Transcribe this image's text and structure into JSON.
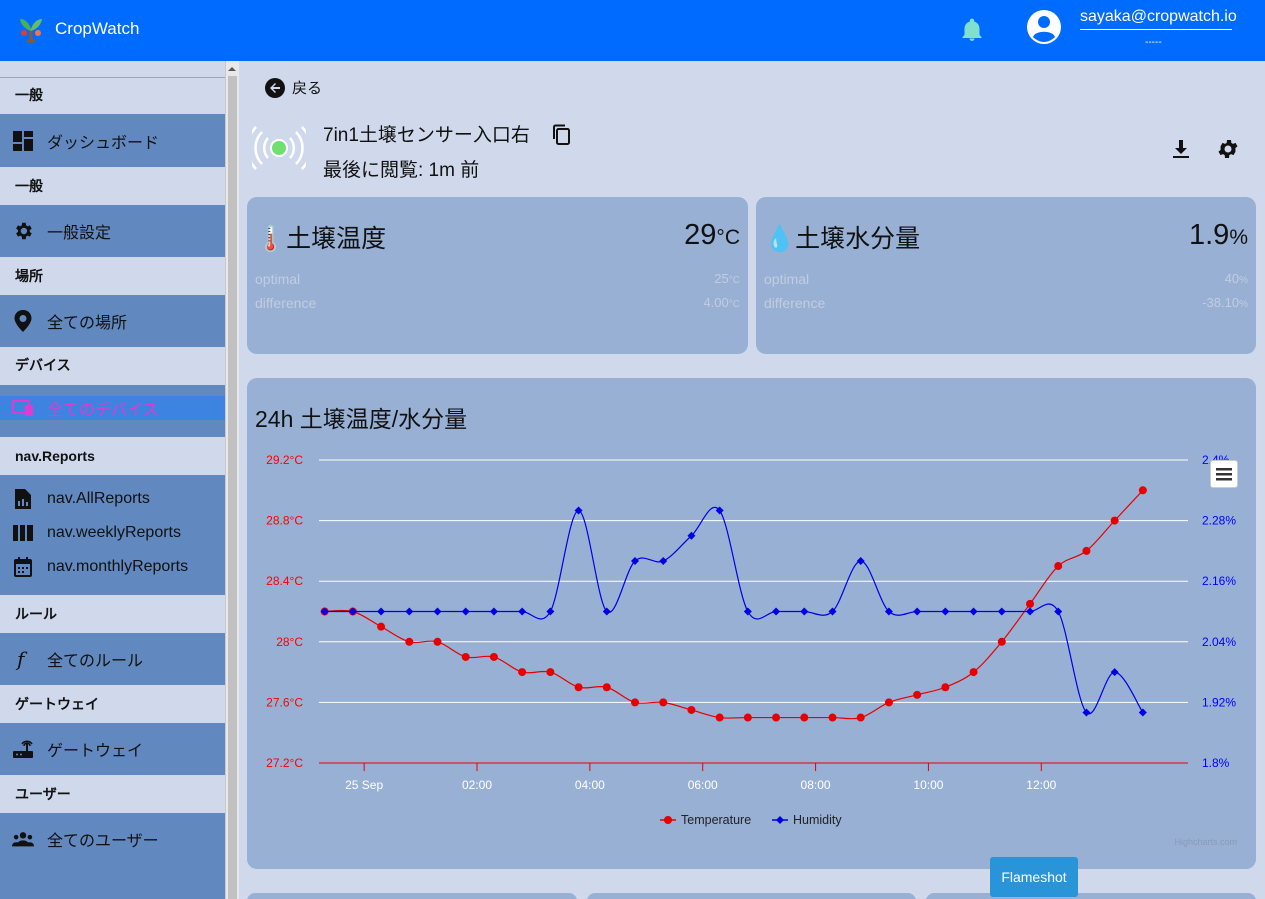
{
  "app": {
    "title": "CropWatch"
  },
  "user": {
    "email": "sayaka@cropwatch.io",
    "sub": "-----"
  },
  "sidebar": {
    "sections": [
      {
        "label": "一般",
        "items": [
          {
            "label": "ダッシュボード",
            "icon": "dashboard-icon"
          }
        ]
      },
      {
        "label": "一般",
        "items": [
          {
            "label": "一般設定",
            "icon": "gear-icon"
          }
        ]
      },
      {
        "label": "場所",
        "items": [
          {
            "label": "全ての場所",
            "icon": "map-pin-icon"
          }
        ]
      },
      {
        "label": "デバイス",
        "items": [
          {
            "label": "全てのデバイス",
            "icon": "devices-icon",
            "active": true
          }
        ]
      },
      {
        "label": "nav.Reports",
        "items": [
          {
            "label": "nav.AllReports",
            "icon": "report-file-icon"
          },
          {
            "label": "nav.weeklyReports",
            "icon": "week-columns-icon"
          },
          {
            "label": "nav.monthlyReports",
            "icon": "calendar-icon"
          }
        ]
      },
      {
        "label": "ルール",
        "items": [
          {
            "label": "全てのルール",
            "icon": "function-icon"
          }
        ]
      },
      {
        "label": "ゲートウェイ",
        "items": [
          {
            "label": "ゲートウェイ",
            "icon": "router-icon"
          }
        ]
      },
      {
        "label": "ユーザー",
        "items": [
          {
            "label": "全てのユーザー",
            "icon": "users-icon"
          }
        ]
      }
    ]
  },
  "main": {
    "back_label": "戻る",
    "device_name": "7in1土壌センサー入口右",
    "last_seen": "最後に閲覧: 1m 前"
  },
  "cards": [
    {
      "icon": "🌡️",
      "title": "土壌温度",
      "value": "29",
      "unit": "°C",
      "rows": [
        {
          "label": "optimal",
          "value": "25",
          "unit": "°C"
        },
        {
          "label": "difference",
          "value": "4.00",
          "unit": "°C"
        }
      ]
    },
    {
      "icon": "💧",
      "title": "土壌水分量",
      "value": "1.9",
      "unit": "%",
      "rows": [
        {
          "label": "optimal",
          "value": "40",
          "unit": "%"
        },
        {
          "label": "difference",
          "value": "-38.10",
          "unit": "%"
        }
      ]
    }
  ],
  "chart_data": {
    "type": "line",
    "title": "24h 土壌温度/水分量",
    "credits": "Highcharts.com",
    "x_labels": [
      "25 Sep",
      "02:00",
      "04:00",
      "06:00",
      "08:00",
      "10:00",
      "12:00"
    ],
    "x_label_hours": [
      0,
      2,
      4,
      6,
      8,
      10,
      12
    ],
    "x_start_hour": -0.8,
    "x_end_hour": 14.6,
    "y_left": {
      "ticks": [
        "27.2°C",
        "27.6°C",
        "28°C",
        "28.4°C",
        "28.8°C",
        "29.2°C"
      ],
      "min": 27.2,
      "max": 29.2,
      "color": "#ff0000"
    },
    "y_right": {
      "ticks": [
        "1.8%",
        "1.92%",
        "2.04%",
        "2.16%",
        "2.28%",
        "2.4%"
      ],
      "min": 1.8,
      "max": 2.4,
      "color": "#0000ff"
    },
    "grid": true,
    "legend": "bottom-center",
    "series": [
      {
        "name": "Temperature",
        "color": "#e60000",
        "marker": "circle",
        "axis": "left",
        "x": [
          -0.7,
          -0.2,
          0.3,
          0.8,
          1.3,
          1.8,
          2.3,
          2.8,
          3.3,
          3.8,
          4.3,
          4.8,
          5.3,
          5.8,
          6.3,
          6.8,
          7.3,
          7.8,
          8.3,
          8.8,
          9.3,
          9.8,
          10.3,
          10.8,
          11.3,
          11.8,
          12.3,
          12.8,
          13.3,
          13.8
        ],
        "values": [
          28.2,
          28.2,
          28.1,
          28.0,
          28.0,
          27.9,
          27.9,
          27.8,
          27.8,
          27.7,
          27.7,
          27.6,
          27.6,
          27.55,
          27.5,
          27.5,
          27.5,
          27.5,
          27.5,
          27.5,
          27.6,
          27.65,
          27.7,
          27.8,
          28.0,
          28.25,
          28.5,
          28.6,
          28.8,
          29.0
        ]
      },
      {
        "name": "Humidity",
        "color": "#0000e6",
        "marker": "diamond",
        "axis": "right",
        "x": [
          -0.7,
          -0.2,
          0.3,
          0.8,
          1.3,
          1.8,
          2.3,
          2.8,
          3.3,
          3.8,
          4.3,
          4.8,
          5.3,
          5.8,
          6.3,
          6.8,
          7.3,
          7.8,
          8.3,
          8.8,
          9.3,
          9.8,
          10.3,
          10.8,
          11.3,
          11.8,
          12.3,
          12.8,
          13.3,
          13.8
        ],
        "values": [
          2.1,
          2.1,
          2.1,
          2.1,
          2.1,
          2.1,
          2.1,
          2.1,
          2.1,
          2.3,
          2.1,
          2.2,
          2.2,
          2.25,
          2.3,
          2.1,
          2.1,
          2.1,
          2.1,
          2.2,
          2.1,
          2.1,
          2.1,
          2.1,
          2.1,
          2.1,
          2.1,
          1.9,
          1.98,
          1.9
        ]
      }
    ]
  },
  "flameshot": "Flameshot"
}
